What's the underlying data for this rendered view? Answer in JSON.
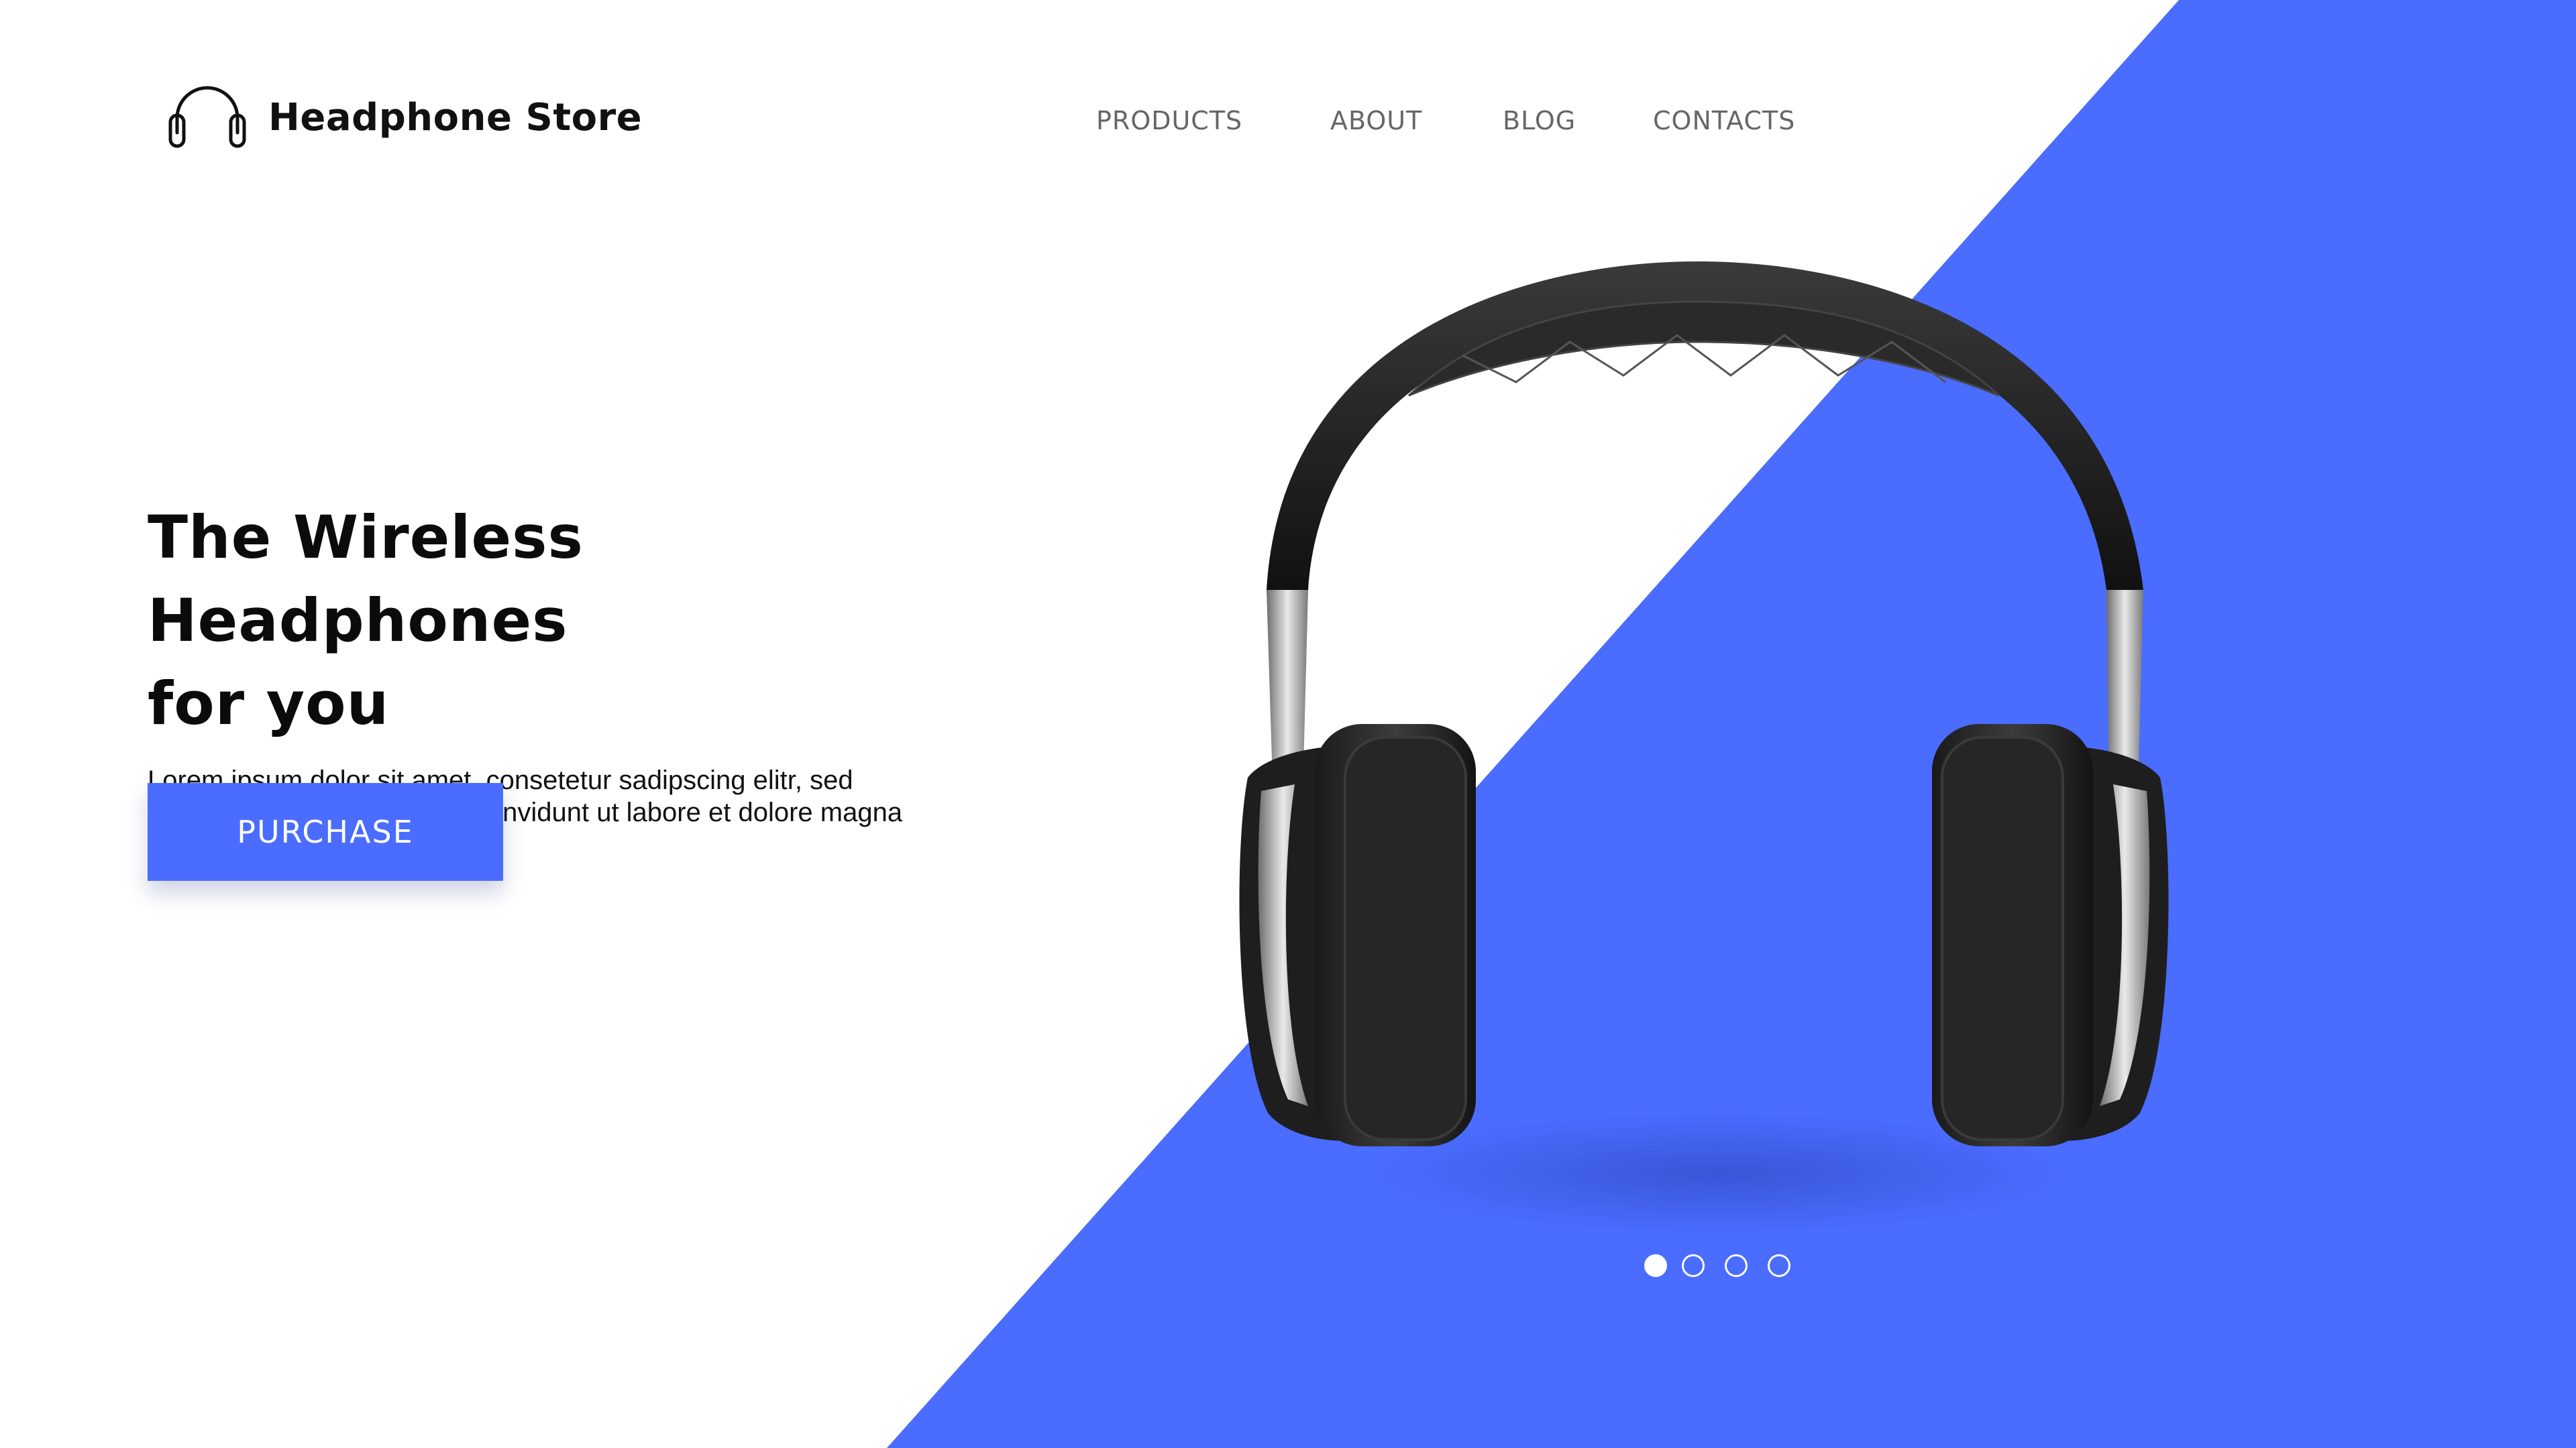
{
  "brand": {
    "name": "Headphone Store",
    "logo_icon": "headphones-icon"
  },
  "nav": {
    "items": [
      {
        "label": "PRODUCTS"
      },
      {
        "label": "ABOUT"
      },
      {
        "label": "BLOG"
      },
      {
        "label": "CONTACTS"
      }
    ]
  },
  "hero": {
    "title_line1": "The Wireless Headphones",
    "title_line2": "for you",
    "description_line1": "Lorem ipsum dolor sit amet, consetetur sadipscing elitr, sed",
    "description_line2": "diam nonumy eirmod tempor invidunt ut labore et dolore magna",
    "cta_label": "PURCHASE",
    "product_image": "headphones-product-image"
  },
  "carousel": {
    "slide_count": 4,
    "active_index": 0
  },
  "colors": {
    "accent": "#4a6cff",
    "background": "#ffffff",
    "text": "#0b0b0b",
    "nav_text": "#666666"
  }
}
